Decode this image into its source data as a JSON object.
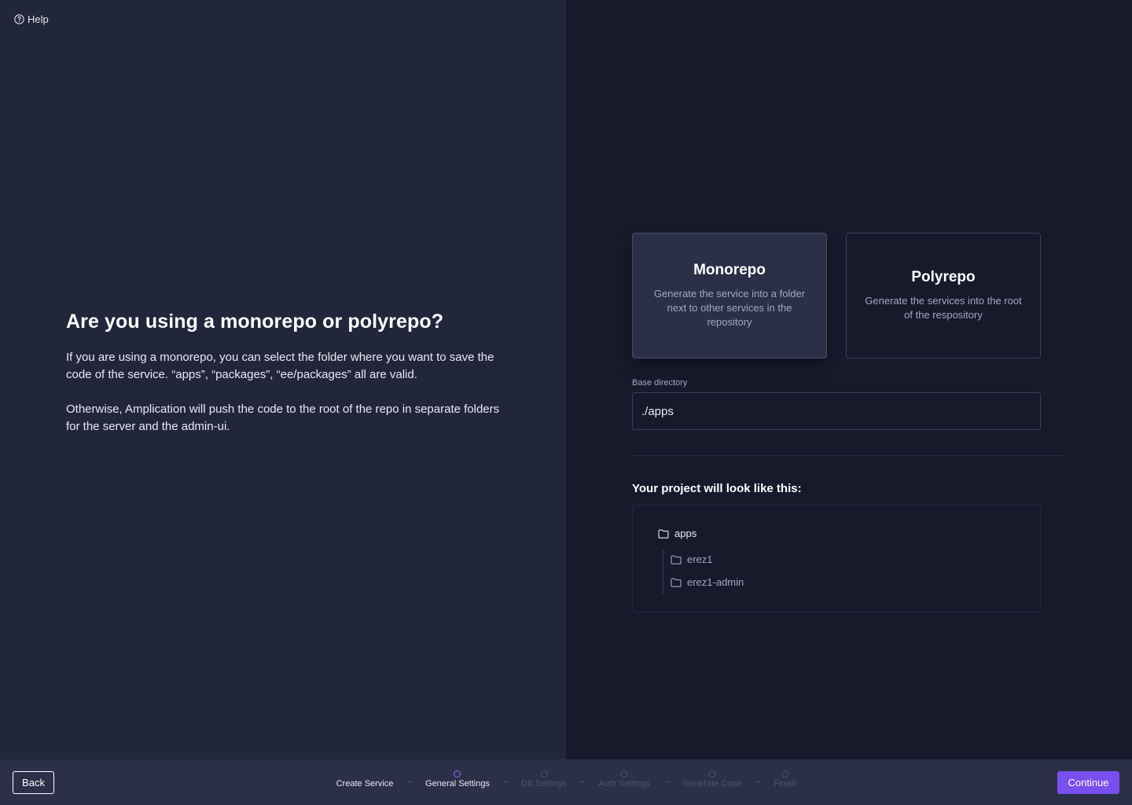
{
  "help": {
    "label": "Help"
  },
  "intro": {
    "title": "Are you using a monorepo or polyrepo?",
    "paragraph1": "If you are using a monorepo, you can select the folder where you want to save the code of the service. “apps”, “packages”, “ee/packages” all are valid.",
    "paragraph2": "Otherwise, Amplication will push the code to the root of the repo in separate folders for the server and the admin-ui."
  },
  "options": {
    "monorepo": {
      "title": "Monorepo",
      "description": "Generate the service into a folder next to other services in the repository",
      "selected": true
    },
    "polyrepo": {
      "title": "Polyrepo",
      "description": "Generate the services into the root of the respository",
      "selected": false
    }
  },
  "base_directory": {
    "label": "Base directory",
    "value": "./apps"
  },
  "preview": {
    "title": "Your project will look like this:",
    "root": "apps",
    "children": [
      "erez1",
      "erez1-admin"
    ]
  },
  "footer": {
    "back_label": "Back",
    "continue_label": "Continue",
    "steps": [
      {
        "label": "Create Service",
        "state": "done"
      },
      {
        "label": "General Settings",
        "state": "active"
      },
      {
        "label": "DB Settings",
        "state": "pending"
      },
      {
        "label": "Auth Settings",
        "state": "pending"
      },
      {
        "label": "Generate Code",
        "state": "pending"
      },
      {
        "label": "Finish",
        "state": "pending"
      }
    ]
  },
  "colors": {
    "accent": "#7950ed",
    "left_bg": "#22263b",
    "right_bg": "#161a2b",
    "footer_bg": "#2b2f48"
  }
}
